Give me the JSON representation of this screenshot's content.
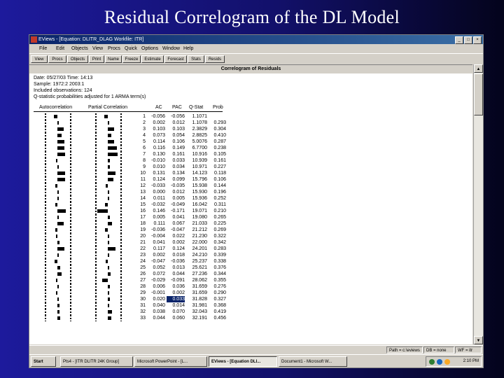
{
  "slide_title": "Residual Correlogram of the DL Model",
  "window": {
    "title": "EViews - [Equation: DLITR_DLAG   Workfile: ITR]",
    "controls": [
      "_",
      "□",
      "×"
    ]
  },
  "menu": [
    "File",
    "Edit",
    "Objects",
    "View",
    "Procs",
    "Quick",
    "Options",
    "Window",
    "Help"
  ],
  "toolbar": [
    "View",
    "Procs",
    "Objects",
    "Print",
    "Name",
    "Freeze",
    "Estimate",
    "Forecast",
    "Stats",
    "Resids"
  ],
  "header": "Correlogram of Residuals",
  "info": {
    "line1": "Date: 05/27/03   Time: 14:13",
    "line2": "Sample: 1972:2 2003:1",
    "line3": "Included observations: 124",
    "line4": "Q-statistic probabilities adjusted for 1 ARMA term(s)"
  },
  "columns": {
    "autocorrelation": "Autocorrelation",
    "partial": "Partial Correlation",
    "ac": "AC",
    "pac": "PAC",
    "qstat": "Q-Stat",
    "prob": "Prob"
  },
  "rows": [
    {
      "lag": "1",
      "ac": "-0.056",
      "pac": "-0.056",
      "q": "1.1071",
      "p": ""
    },
    {
      "lag": "2",
      "ac": "0.002",
      "pac": "0.012",
      "q": "1.1078",
      "p": "0.293"
    },
    {
      "lag": "3",
      "ac": "0.103",
      "pac": "0.103",
      "q": "2.3829",
      "p": "0.304"
    },
    {
      "lag": "4",
      "ac": "0.073",
      "pac": "0.054",
      "q": "2.8825",
      "p": "0.410"
    },
    {
      "lag": "5",
      "ac": "0.114",
      "pac": "0.106",
      "q": "5.0076",
      "p": "0.287"
    },
    {
      "lag": "6",
      "ac": "0.116",
      "pac": "0.149",
      "q": "6.7700",
      "p": "0.238"
    },
    {
      "lag": "7",
      "ac": "0.130",
      "pac": "0.161",
      "q": "10.916",
      "p": "0.105"
    },
    {
      "lag": "8",
      "ac": "-0.010",
      "pac": "0.033",
      "q": "10.939",
      "p": "0.161"
    },
    {
      "lag": "9",
      "ac": "0.010",
      "pac": "0.034",
      "q": "10.971",
      "p": "0.227"
    },
    {
      "lag": "10",
      "ac": "0.131",
      "pac": "0.134",
      "q": "14.123",
      "p": "0.118"
    },
    {
      "lag": "11",
      "ac": "0.124",
      "pac": "0.099",
      "q": "15.796",
      "p": "0.106"
    },
    {
      "lag": "12",
      "ac": "-0.033",
      "pac": "-0.035",
      "q": "15.938",
      "p": "0.144"
    },
    {
      "lag": "13",
      "ac": "0.000",
      "pac": "0.012",
      "q": "15.930",
      "p": "0.196"
    },
    {
      "lag": "14",
      "ac": "0.011",
      "pac": "0.005",
      "q": "15.936",
      "p": "0.252"
    },
    {
      "lag": "15",
      "ac": "-0.032",
      "pac": "-0.049",
      "q": "16.042",
      "p": "0.311"
    },
    {
      "lag": "16",
      "ac": "0.146",
      "pac": "-0.171",
      "q": "19.071",
      "p": "0.210"
    },
    {
      "lag": "17",
      "ac": "0.005",
      "pac": "0.041",
      "q": "19.080",
      "p": "0.265"
    },
    {
      "lag": "18",
      "ac": "0.111",
      "pac": "0.067",
      "q": "21.033",
      "p": "0.225"
    },
    {
      "lag": "19",
      "ac": "-0.036",
      "pac": "-0.047",
      "q": "21.212",
      "p": "0.269"
    },
    {
      "lag": "20",
      "ac": "-0.004",
      "pac": "0.022",
      "q": "21.230",
      "p": "0.322"
    },
    {
      "lag": "21",
      "ac": "0.041",
      "pac": "0.002",
      "q": "22.000",
      "p": "0.342"
    },
    {
      "lag": "22",
      "ac": "0.117",
      "pac": "0.124",
      "q": "24.201",
      "p": "0.283"
    },
    {
      "lag": "23",
      "ac": "0.002",
      "pac": "0.018",
      "q": "24.210",
      "p": "0.339"
    },
    {
      "lag": "24",
      "ac": "-0.047",
      "pac": "-0.036",
      "q": "25.237",
      "p": "0.338"
    },
    {
      "lag": "25",
      "ac": "0.052",
      "pac": "0.013",
      "q": "25.621",
      "p": "0.376"
    },
    {
      "lag": "26",
      "ac": "0.072",
      "pac": "0.044",
      "q": "27.236",
      "p": "0.344"
    },
    {
      "lag": "27",
      "ac": "-0.029",
      "pac": "-0.091",
      "q": "28.062",
      "p": "0.355"
    },
    {
      "lag": "28",
      "ac": "0.006",
      "pac": "0.036",
      "q": "31.659",
      "p": "0.276"
    },
    {
      "lag": "29",
      "ac": "-0.001",
      "pac": "0.002",
      "q": "31.659",
      "p": "0.290"
    },
    {
      "lag": "30",
      "ac": "0.020",
      "pac": "0.033",
      "q": "31.828",
      "p": "0.327"
    },
    {
      "lag": "31",
      "ac": "0.040",
      "pac": "0.014",
      "q": "31.981",
      "p": "0.368"
    },
    {
      "lag": "32",
      "ac": "0.038",
      "pac": "0.070",
      "q": "32.043",
      "p": "0.419"
    },
    {
      "lag": "33",
      "ac": "0.044",
      "pac": "0.060",
      "q": "32.191",
      "p": "0.456"
    }
  ],
  "selected": {
    "row": 29,
    "field": "pac"
  },
  "status": {
    "path": "Path = c:\\eviews",
    "db": "DB = none",
    "wf": "WF = itr"
  },
  "taskbar": {
    "start": "Start",
    "buttons": [
      "Pts4 - [ITR DLITR 24K Group]",
      "Microsoft PowerPoint - [L...",
      "EViews - [Equation DLI...",
      "Document1 - Microsoft W..."
    ],
    "active": 2,
    "clock": "2:10 PM"
  }
}
